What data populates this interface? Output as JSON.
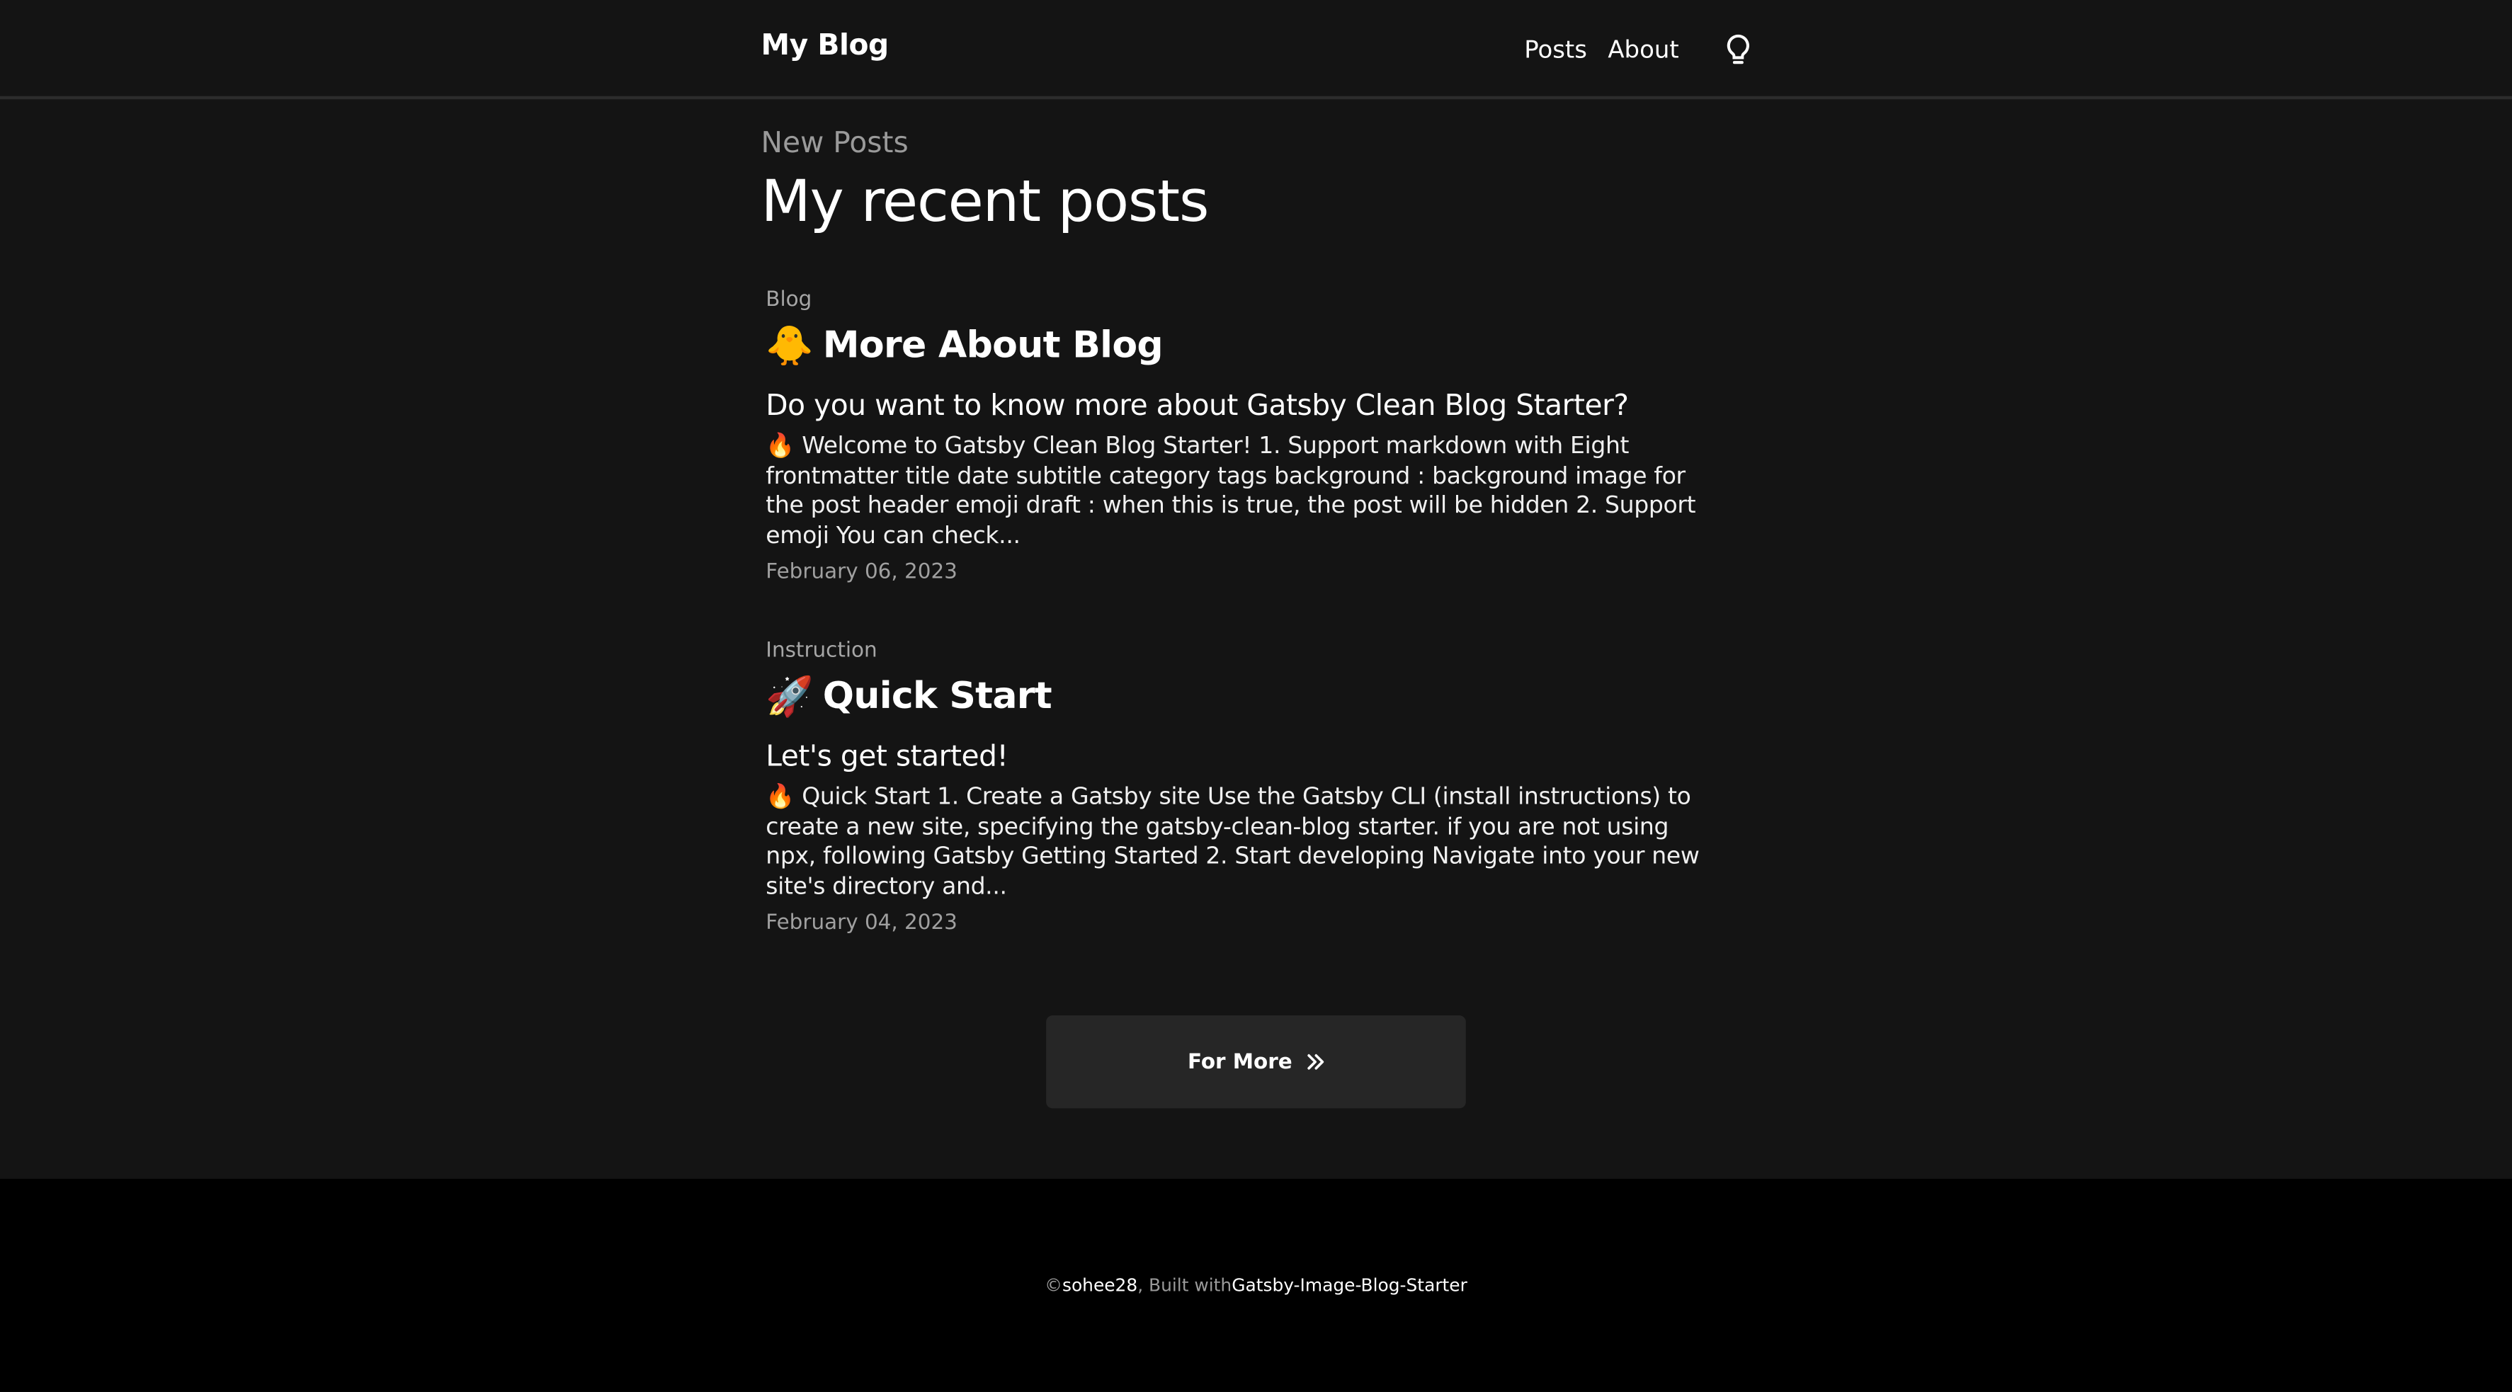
{
  "header": {
    "brand": "My Blog",
    "nav": [
      {
        "label": "Posts"
      },
      {
        "label": "About"
      }
    ],
    "theme_icon": "lightbulb-icon"
  },
  "main": {
    "eyebrow": "New Posts",
    "title": "My recent posts",
    "posts": [
      {
        "category": "Blog",
        "emoji": "🐥",
        "title": "More About Blog",
        "subtitle": "Do you want to know more about Gatsby Clean Blog Starter?",
        "excerpt": "🔥 Welcome to Gatsby Clean Blog Starter!   1. Support markdown with Eight frontmatter title date subtitle category tags background : background image for the post header emoji draft : when this is true, the post will be hidden 2. Support emoji You can check...",
        "date": "February 06, 2023"
      },
      {
        "category": "Instruction",
        "emoji": "🚀",
        "title": "Quick Start",
        "subtitle": "Let's get started!",
        "excerpt": "🔥 Quick Start 1. Create a Gatsby site Use the Gatsby CLI (install instructions) to create a new site, specifying the gatsby-clean-blog starter. if you are not using npx, following Gatsby Getting Started 2. Start developing Navigate into your new site's directory and...",
        "date": "February 04, 2023"
      }
    ],
    "more_button": "For More",
    "more_icon": "double-chevron-right-icon"
  },
  "footer": {
    "copyright_prefix": "©",
    "author": "sohee28",
    "built_with_text": ", Built with",
    "starter_link": "Gatsby-Image-Blog-Starter"
  }
}
